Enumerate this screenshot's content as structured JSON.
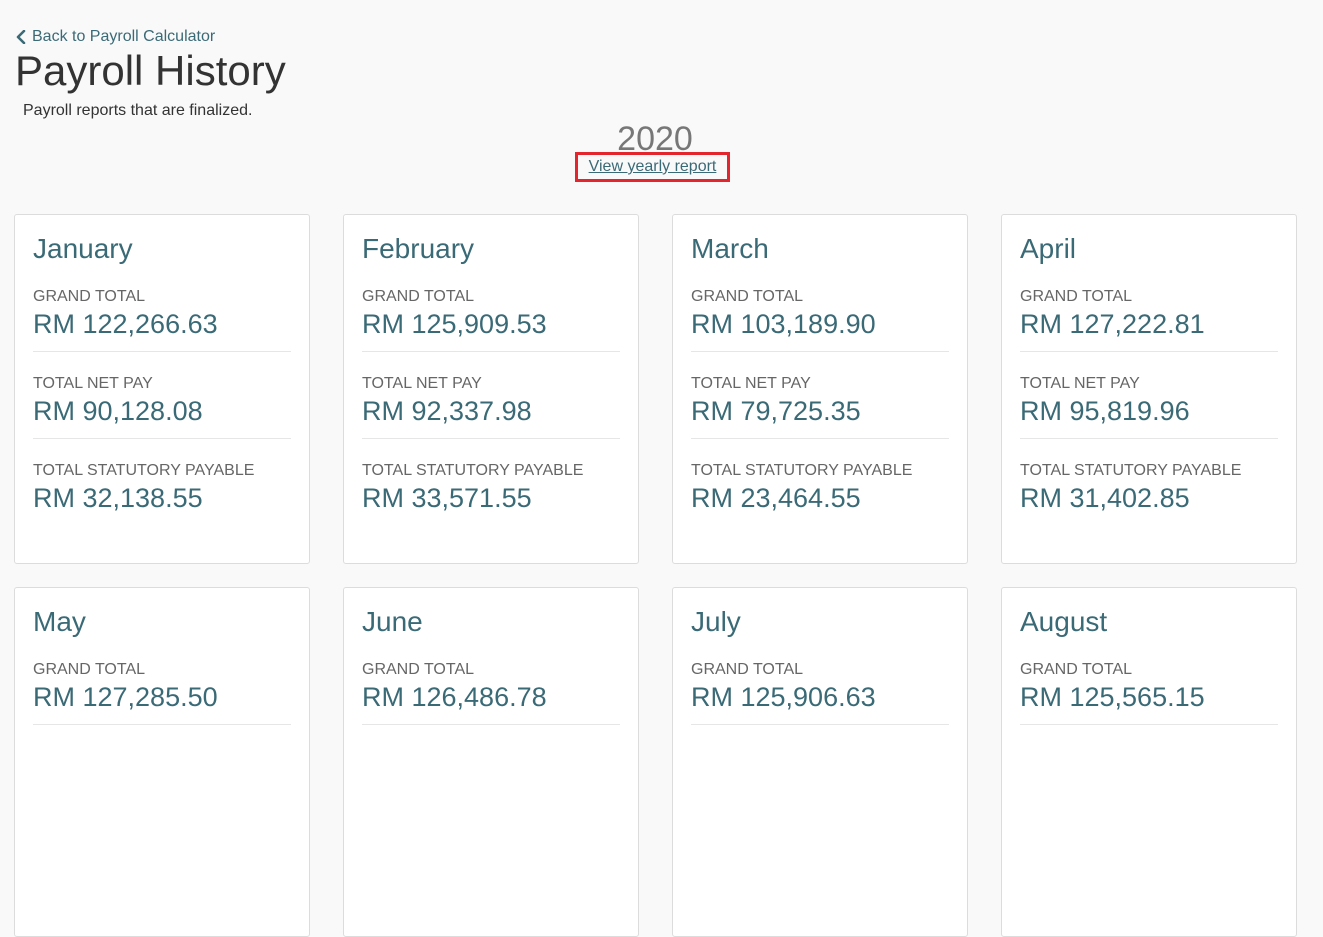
{
  "header": {
    "back_label": "Back to Payroll Calculator",
    "title": "Payroll History",
    "subtitle": "Payroll reports that are finalized."
  },
  "year": {
    "value": "2020",
    "yearly_report_label": "View yearly report"
  },
  "labels": {
    "grand_total": "GRAND TOTAL",
    "total_net_pay": "TOTAL NET PAY",
    "total_statutory": "TOTAL STATUTORY PAYABLE"
  },
  "months": [
    {
      "name": "January",
      "grand_total": "RM 122,266.63",
      "net_pay": "RM 90,128.08",
      "statutory": "RM 32,138.55"
    },
    {
      "name": "February",
      "grand_total": "RM 125,909.53",
      "net_pay": "RM 92,337.98",
      "statutory": "RM 33,571.55"
    },
    {
      "name": "March",
      "grand_total": "RM 103,189.90",
      "net_pay": "RM 79,725.35",
      "statutory": "RM 23,464.55"
    },
    {
      "name": "April",
      "grand_total": "RM 127,222.81",
      "net_pay": "RM 95,819.96",
      "statutory": "RM 31,402.85"
    },
    {
      "name": "May",
      "grand_total": "RM 127,285.50"
    },
    {
      "name": "June",
      "grand_total": "RM 126,486.78"
    },
    {
      "name": "July",
      "grand_total": "RM 125,906.63"
    },
    {
      "name": "August",
      "grand_total": "RM 125,565.15"
    }
  ],
  "colors": {
    "accent": "#3b6a77",
    "highlight_box": "#e3262e",
    "background": "#f9f9f9"
  }
}
